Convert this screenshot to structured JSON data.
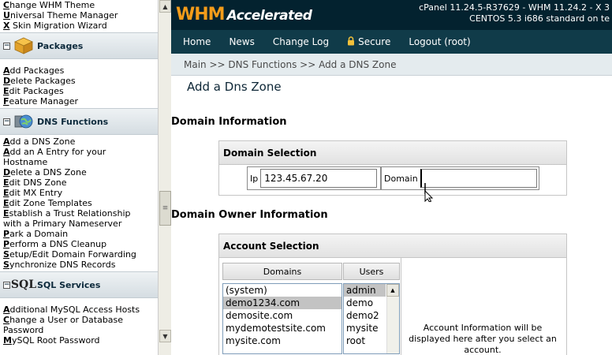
{
  "sidebar": {
    "top_links": [
      {
        "key": "C",
        "rest": "hange WHM Theme"
      },
      {
        "key": "U",
        "rest": "niversal Theme Manager"
      },
      {
        "key": "X",
        "rest": " Skin Migration Wizard"
      }
    ],
    "packages": {
      "title": "Packages",
      "links": [
        {
          "key": "A",
          "rest": "dd Packages"
        },
        {
          "key": "D",
          "rest": "elete Packages"
        },
        {
          "key": "E",
          "rest": "dit Packages"
        },
        {
          "key": "F",
          "rest": "eature Manager"
        }
      ]
    },
    "dns": {
      "title": "DNS Functions",
      "links": [
        {
          "key": "A",
          "rest": "dd a DNS Zone"
        },
        {
          "key": "A",
          "rest": "dd an A Entry for your"
        },
        {
          "key": "",
          "rest": "Hostname"
        },
        {
          "key": "D",
          "rest": "elete a DNS Zone"
        },
        {
          "key": "E",
          "rest": "dit DNS Zone"
        },
        {
          "key": "E",
          "rest": "dit MX Entry"
        },
        {
          "key": "E",
          "rest": "dit Zone Templates"
        },
        {
          "key": "E",
          "rest": "stablish a Trust Relationship"
        },
        {
          "key": "",
          "rest": "with a Primary Nameserver"
        },
        {
          "key": "P",
          "rest": "ark a Domain"
        },
        {
          "key": "P",
          "rest": "erform a DNS Cleanup"
        },
        {
          "key": "S",
          "rest": "etup/Edit Domain Forwarding"
        },
        {
          "key": "S",
          "rest": "ynchronize DNS Records"
        }
      ]
    },
    "sql": {
      "title": "SQL Services",
      "logo_text": "SQL",
      "links": [
        {
          "key": "A",
          "rest": "dditional MySQL Access Hosts"
        },
        {
          "key": "C",
          "rest": "hange a User or Database"
        },
        {
          "key": "",
          "rest": "Password"
        },
        {
          "key": "M",
          "rest": "ySQL Root Password"
        }
      ]
    }
  },
  "header": {
    "logo_main": "WHM",
    "logo_sub": "Accelerated",
    "version_line1": "cPanel 11.24.5-R37629 - WHM 11.24.2 - X 3",
    "version_line2": "CENTOS 5.3 i686 standard on te"
  },
  "nav": {
    "home": "Home",
    "news": "News",
    "changelog": "Change Log",
    "secure": "Secure",
    "logout": "Logout (root)"
  },
  "breadcrumb": "Main >> DNS Functions >> Add a DNS Zone",
  "page_title": "Add a Dns Zone",
  "domain_info": {
    "section_title": "Domain Information",
    "panel_title": "Domain Selection",
    "ip_label": "Ip",
    "ip_value": "123.45.67.20",
    "domain_label": "Domain",
    "domain_value": ""
  },
  "owner_info": {
    "section_title": "Domain Owner Information",
    "panel_title": "Account Selection",
    "domains_header": "Domains",
    "users_header": "Users",
    "domains": [
      "(system)",
      "demo1234.com",
      "demosite.com",
      "mydemotestsite.com",
      "mysite.com"
    ],
    "users": [
      "admin",
      "demo",
      "demo2",
      "mysite",
      "root"
    ],
    "selected_domain_index": 1,
    "selected_user_index": 0,
    "account_info": "Account Information will be displayed here after you select an account."
  },
  "colors": {
    "topbar": "#03222f",
    "navbar": "#103b49",
    "logo_orange": "#f39c1a",
    "breadcrumb_bg": "#e4ebee"
  }
}
